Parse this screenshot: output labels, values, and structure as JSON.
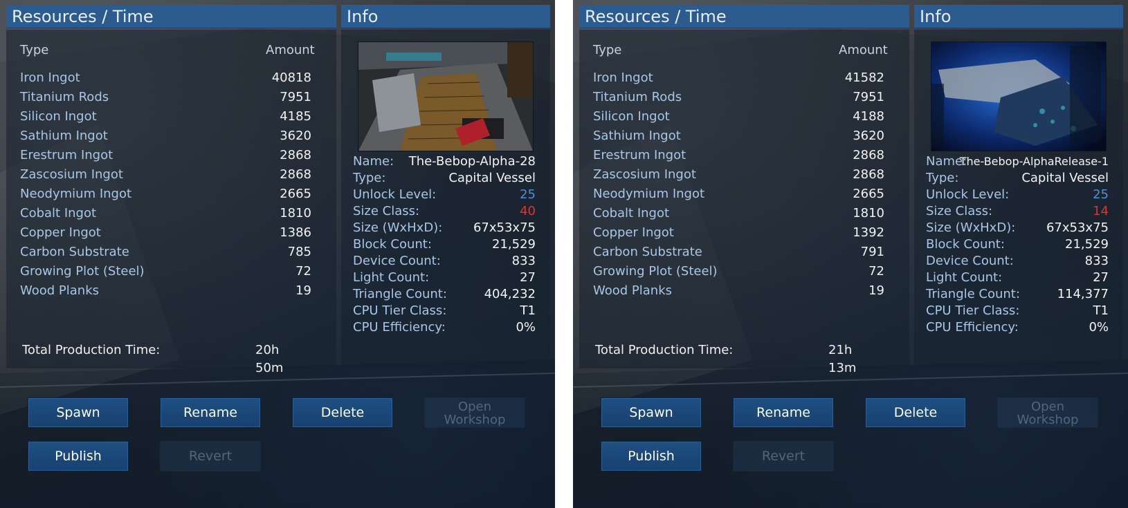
{
  "colors": {
    "header_bg": "#2b5b8f",
    "label_blue": "#a9c6e6",
    "value_white": "#f4f4f4",
    "unlock_level": "#4f8fd6",
    "size_class": "#e0322f",
    "button_bg": "#1f4f84"
  },
  "panels": [
    {
      "resources_header": "Resources / Time",
      "info_header": "Info",
      "type_label": "Type",
      "amount_label": "Amount",
      "resources": [
        {
          "name": "Iron Ingot",
          "amount": "40818"
        },
        {
          "name": "Titanium Rods",
          "amount": "7951"
        },
        {
          "name": "Silicon Ingot",
          "amount": "4185"
        },
        {
          "name": "Sathium Ingot",
          "amount": "3620"
        },
        {
          "name": "Erestrum Ingot",
          "amount": "2868"
        },
        {
          "name": "Zascosium Ingot",
          "amount": "2868"
        },
        {
          "name": "Neodymium Ingot",
          "amount": "2665"
        },
        {
          "name": "Cobalt Ingot",
          "amount": "1810"
        },
        {
          "name": "Copper Ingot",
          "amount": "1386"
        },
        {
          "name": "Carbon Substrate",
          "amount": "785"
        },
        {
          "name": "Growing Plot (Steel)",
          "amount": "72"
        },
        {
          "name": "Wood Planks",
          "amount": "19"
        }
      ],
      "total_label": "Total Production Time:",
      "total_value": "20h 50m",
      "info": [
        {
          "label": "Name:",
          "value": "The-Bebop-Alpha-28"
        },
        {
          "label": "Type:",
          "value": "Capital Vessel"
        },
        {
          "label": "Unlock Level:",
          "value": "25"
        },
        {
          "label": "Size Class:",
          "value": "40"
        },
        {
          "label": "Size (WxHxD):",
          "value": "67x53x75"
        },
        {
          "label": "Block Count:",
          "value": "21,529"
        },
        {
          "label": "Device Count:",
          "value": "833"
        },
        {
          "label": "Light Count:",
          "value": "27"
        },
        {
          "label": "Triangle Count:",
          "value": "404,232"
        },
        {
          "label": "CPU Tier Class:",
          "value": "T1"
        },
        {
          "label": "CPU Efficiency:",
          "value": "0%"
        }
      ],
      "buttons": {
        "spawn": "Spawn",
        "rename": "Rename",
        "delete": "Delete",
        "open_workshop_line1": "Open",
        "open_workshop_line2": "Workshop",
        "publish": "Publish",
        "revert": "Revert"
      }
    },
    {
      "resources_header": "Resources / Time",
      "info_header": "Info",
      "type_label": "Type",
      "amount_label": "Amount",
      "resources": [
        {
          "name": "Iron Ingot",
          "amount": "41582"
        },
        {
          "name": "Titanium Rods",
          "amount": "7951"
        },
        {
          "name": "Silicon Ingot",
          "amount": "4188"
        },
        {
          "name": "Sathium Ingot",
          "amount": "3620"
        },
        {
          "name": "Erestrum Ingot",
          "amount": "2868"
        },
        {
          "name": "Zascosium Ingot",
          "amount": "2868"
        },
        {
          "name": "Neodymium Ingot",
          "amount": "2665"
        },
        {
          "name": "Cobalt Ingot",
          "amount": "1810"
        },
        {
          "name": "Copper Ingot",
          "amount": "1392"
        },
        {
          "name": "Carbon Substrate",
          "amount": "791"
        },
        {
          "name": "Growing Plot (Steel)",
          "amount": "72"
        },
        {
          "name": "Wood Planks",
          "amount": "19"
        }
      ],
      "total_label": "Total Production Time:",
      "total_value": "21h 13m",
      "info": [
        {
          "label": "Name:",
          "value": "The-Bebop-AlphaRelease-1"
        },
        {
          "label": "Type:",
          "value": "Capital Vessel"
        },
        {
          "label": "Unlock Level:",
          "value": "25"
        },
        {
          "label": "Size Class:",
          "value": "14"
        },
        {
          "label": "Size (WxHxD):",
          "value": "67x53x75"
        },
        {
          "label": "Block Count:",
          "value": "21,529"
        },
        {
          "label": "Device Count:",
          "value": "833"
        },
        {
          "label": "Light Count:",
          "value": "27"
        },
        {
          "label": "Triangle Count:",
          "value": "114,377"
        },
        {
          "label": "CPU Tier Class:",
          "value": "T1"
        },
        {
          "label": "CPU Efficiency:",
          "value": "0%"
        }
      ],
      "buttons": {
        "spawn": "Spawn",
        "rename": "Rename",
        "delete": "Delete",
        "open_workshop_line1": "Open",
        "open_workshop_line2": "Workshop",
        "publish": "Publish",
        "revert": "Revert"
      }
    }
  ]
}
